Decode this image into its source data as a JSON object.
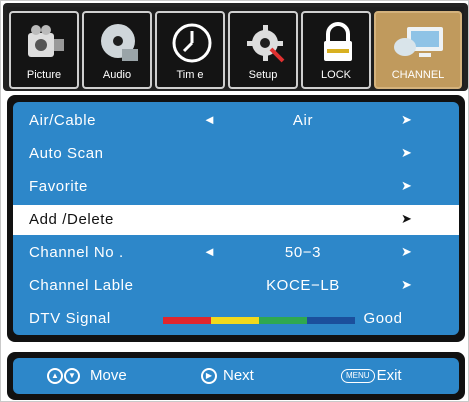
{
  "tabs": [
    {
      "label": "Picture",
      "icon": "camcorder-icon",
      "active": false
    },
    {
      "label": "Audio",
      "icon": "cd-disc-icon",
      "active": false
    },
    {
      "label": "Tim e",
      "icon": "clock-icon",
      "active": false
    },
    {
      "label": "Setup",
      "icon": "gear-wrench-icon",
      "active": false
    },
    {
      "label": "LOCK",
      "icon": "padlock-icon",
      "active": false
    },
    {
      "label": "CHANNEL",
      "icon": "satellite-dish-icon",
      "active": true
    }
  ],
  "menu": {
    "rows": [
      {
        "name": "Air/Cable",
        "left": "◄",
        "value": "Air",
        "right": "➤"
      },
      {
        "name": "Auto Scan",
        "left": "",
        "value": "",
        "right": "➤"
      },
      {
        "name": "Favorite",
        "left": "",
        "value": "",
        "right": "➤"
      },
      {
        "name": "Add /Delete",
        "left": "",
        "value": "",
        "right": "➤",
        "selected": true
      },
      {
        "name": "Channel No .",
        "left": "◄",
        "value": "50−3",
        "right": "➤"
      },
      {
        "name": "Channel Lable",
        "left": "",
        "value": "KOCE−LB",
        "right": "➤"
      },
      {
        "name": "DTV Signal",
        "left": "",
        "value": "Good",
        "right": ""
      }
    ],
    "signal_colors": [
      "#e0262e",
      "#f1d91c",
      "#2fa84f",
      "#1b4f9c"
    ]
  },
  "help": {
    "move_label": "Move",
    "next_label": "Next",
    "menu_key": "MENU",
    "exit_label": "Exit"
  },
  "colors": {
    "menu_blue": "#2d87c9",
    "active_tab": "#c09a5d"
  }
}
